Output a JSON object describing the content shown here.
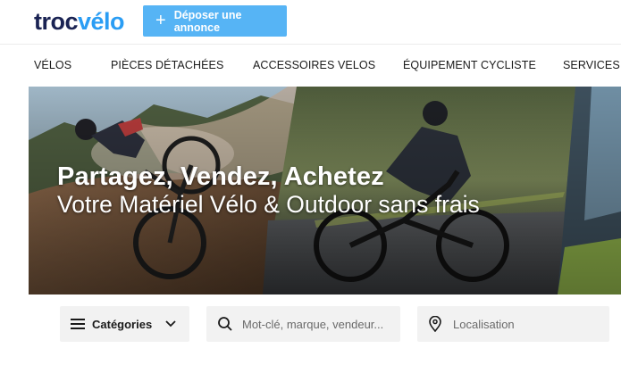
{
  "brand": {
    "logo_part1": "troc",
    "logo_part2": "vélo"
  },
  "header": {
    "cta_label": "Déposer une annonce",
    "cta_icon": "plus-icon"
  },
  "nav": {
    "items": [
      {
        "label": "VÉLOS"
      },
      {
        "label": "PIÈCES DÉTACHÉES"
      },
      {
        "label": "ACCESSOIRES VELOS"
      },
      {
        "label": "ÉQUIPEMENT CYCLISTE"
      },
      {
        "label": "SERVICES"
      }
    ]
  },
  "hero": {
    "headline": "Partagez, Vendez, Achetez",
    "subheadline": "Votre Matériel Vélo & Outdoor sans frais"
  },
  "search": {
    "categories_label": "Catégories",
    "keyword_placeholder": "Mot-clé, marque, vendeur...",
    "location_placeholder": "Localisation"
  },
  "colors": {
    "brand_navy": "#1a2353",
    "brand_blue": "#2a9df4",
    "cta_bg": "#56b4f5",
    "field_bg": "#f2f2f2"
  }
}
